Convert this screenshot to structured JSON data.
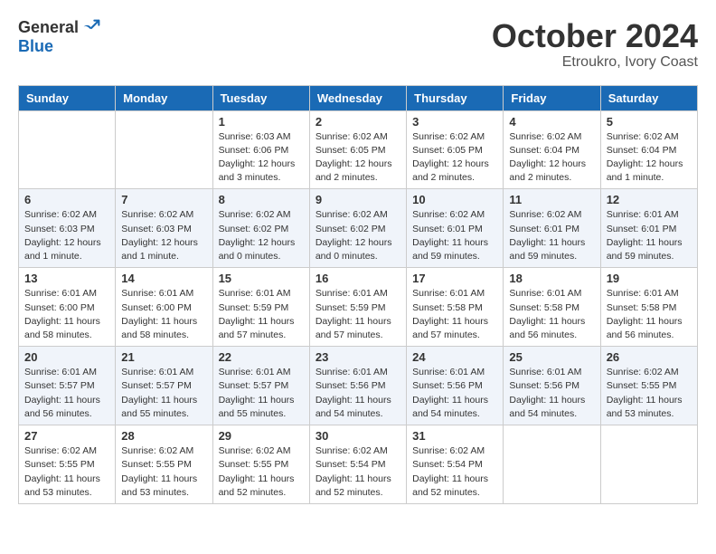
{
  "logo": {
    "general": "General",
    "blue": "Blue"
  },
  "header": {
    "month": "October 2024",
    "location": "Etroukro, Ivory Coast"
  },
  "weekdays": [
    "Sunday",
    "Monday",
    "Tuesday",
    "Wednesday",
    "Thursday",
    "Friday",
    "Saturday"
  ],
  "weeks": [
    [
      {
        "day": "",
        "info": ""
      },
      {
        "day": "",
        "info": ""
      },
      {
        "day": "1",
        "info": "Sunrise: 6:03 AM\nSunset: 6:06 PM\nDaylight: 12 hours and 3 minutes."
      },
      {
        "day": "2",
        "info": "Sunrise: 6:02 AM\nSunset: 6:05 PM\nDaylight: 12 hours and 2 minutes."
      },
      {
        "day": "3",
        "info": "Sunrise: 6:02 AM\nSunset: 6:05 PM\nDaylight: 12 hours and 2 minutes."
      },
      {
        "day": "4",
        "info": "Sunrise: 6:02 AM\nSunset: 6:04 PM\nDaylight: 12 hours and 2 minutes."
      },
      {
        "day": "5",
        "info": "Sunrise: 6:02 AM\nSunset: 6:04 PM\nDaylight: 12 hours and 1 minute."
      }
    ],
    [
      {
        "day": "6",
        "info": "Sunrise: 6:02 AM\nSunset: 6:03 PM\nDaylight: 12 hours and 1 minute."
      },
      {
        "day": "7",
        "info": "Sunrise: 6:02 AM\nSunset: 6:03 PM\nDaylight: 12 hours and 1 minute."
      },
      {
        "day": "8",
        "info": "Sunrise: 6:02 AM\nSunset: 6:02 PM\nDaylight: 12 hours and 0 minutes."
      },
      {
        "day": "9",
        "info": "Sunrise: 6:02 AM\nSunset: 6:02 PM\nDaylight: 12 hours and 0 minutes."
      },
      {
        "day": "10",
        "info": "Sunrise: 6:02 AM\nSunset: 6:01 PM\nDaylight: 11 hours and 59 minutes."
      },
      {
        "day": "11",
        "info": "Sunrise: 6:02 AM\nSunset: 6:01 PM\nDaylight: 11 hours and 59 minutes."
      },
      {
        "day": "12",
        "info": "Sunrise: 6:01 AM\nSunset: 6:01 PM\nDaylight: 11 hours and 59 minutes."
      }
    ],
    [
      {
        "day": "13",
        "info": "Sunrise: 6:01 AM\nSunset: 6:00 PM\nDaylight: 11 hours and 58 minutes."
      },
      {
        "day": "14",
        "info": "Sunrise: 6:01 AM\nSunset: 6:00 PM\nDaylight: 11 hours and 58 minutes."
      },
      {
        "day": "15",
        "info": "Sunrise: 6:01 AM\nSunset: 5:59 PM\nDaylight: 11 hours and 57 minutes."
      },
      {
        "day": "16",
        "info": "Sunrise: 6:01 AM\nSunset: 5:59 PM\nDaylight: 11 hours and 57 minutes."
      },
      {
        "day": "17",
        "info": "Sunrise: 6:01 AM\nSunset: 5:58 PM\nDaylight: 11 hours and 57 minutes."
      },
      {
        "day": "18",
        "info": "Sunrise: 6:01 AM\nSunset: 5:58 PM\nDaylight: 11 hours and 56 minutes."
      },
      {
        "day": "19",
        "info": "Sunrise: 6:01 AM\nSunset: 5:58 PM\nDaylight: 11 hours and 56 minutes."
      }
    ],
    [
      {
        "day": "20",
        "info": "Sunrise: 6:01 AM\nSunset: 5:57 PM\nDaylight: 11 hours and 56 minutes."
      },
      {
        "day": "21",
        "info": "Sunrise: 6:01 AM\nSunset: 5:57 PM\nDaylight: 11 hours and 55 minutes."
      },
      {
        "day": "22",
        "info": "Sunrise: 6:01 AM\nSunset: 5:57 PM\nDaylight: 11 hours and 55 minutes."
      },
      {
        "day": "23",
        "info": "Sunrise: 6:01 AM\nSunset: 5:56 PM\nDaylight: 11 hours and 54 minutes."
      },
      {
        "day": "24",
        "info": "Sunrise: 6:01 AM\nSunset: 5:56 PM\nDaylight: 11 hours and 54 minutes."
      },
      {
        "day": "25",
        "info": "Sunrise: 6:01 AM\nSunset: 5:56 PM\nDaylight: 11 hours and 54 minutes."
      },
      {
        "day": "26",
        "info": "Sunrise: 6:02 AM\nSunset: 5:55 PM\nDaylight: 11 hours and 53 minutes."
      }
    ],
    [
      {
        "day": "27",
        "info": "Sunrise: 6:02 AM\nSunset: 5:55 PM\nDaylight: 11 hours and 53 minutes."
      },
      {
        "day": "28",
        "info": "Sunrise: 6:02 AM\nSunset: 5:55 PM\nDaylight: 11 hours and 53 minutes."
      },
      {
        "day": "29",
        "info": "Sunrise: 6:02 AM\nSunset: 5:55 PM\nDaylight: 11 hours and 52 minutes."
      },
      {
        "day": "30",
        "info": "Sunrise: 6:02 AM\nSunset: 5:54 PM\nDaylight: 11 hours and 52 minutes."
      },
      {
        "day": "31",
        "info": "Sunrise: 6:02 AM\nSunset: 5:54 PM\nDaylight: 11 hours and 52 minutes."
      },
      {
        "day": "",
        "info": ""
      },
      {
        "day": "",
        "info": ""
      }
    ]
  ]
}
